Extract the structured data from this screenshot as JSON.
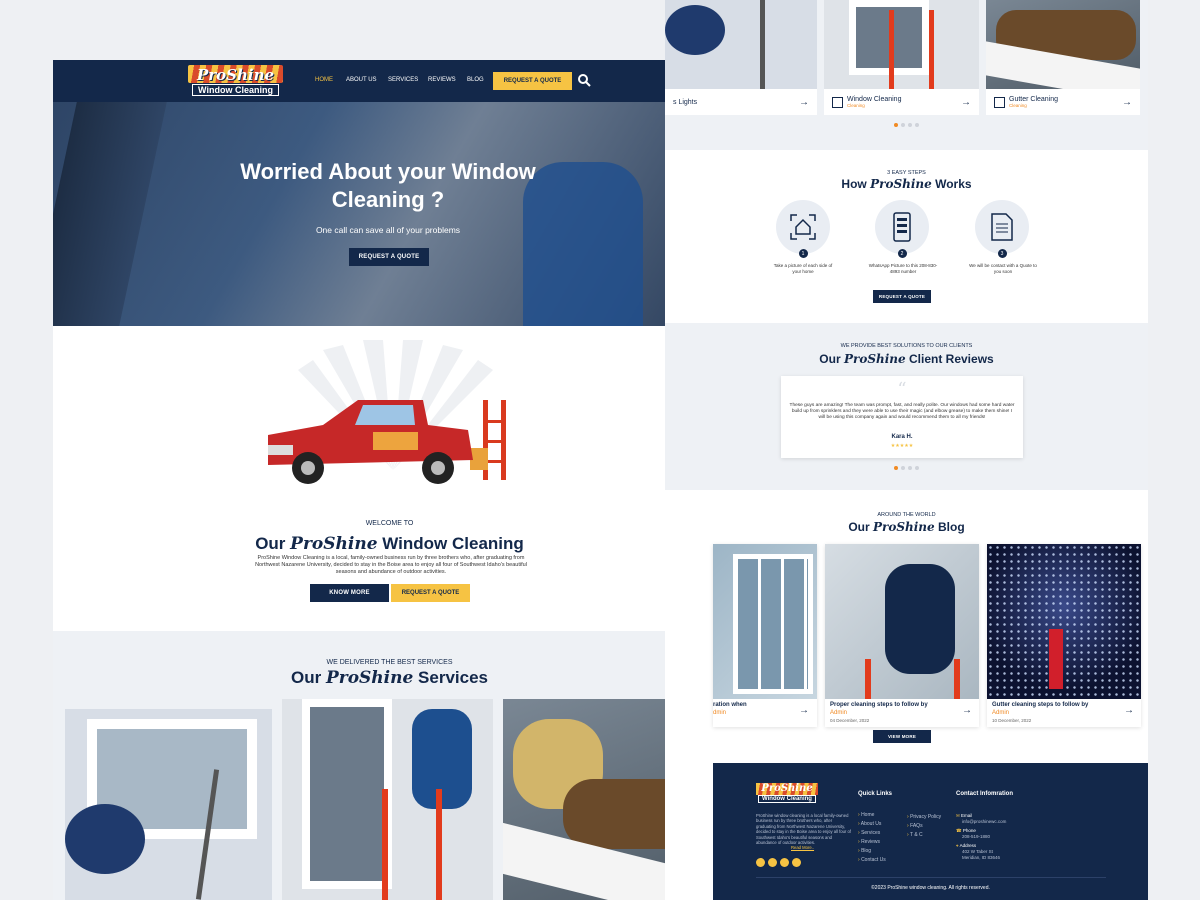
{
  "nav": {
    "logo_top": "ProShine",
    "logo_bottom": "Window Cleaning",
    "items": [
      "HOME",
      "ABOUT US",
      "SERVICES",
      "REVIEWS",
      "BLOG"
    ],
    "cta": "REQUEST A QUOTE"
  },
  "hero": {
    "title": "Worried About your Window Cleaning ?",
    "subtitle": "One call can save all of your problems",
    "cta": "REQUEST A QUOTE"
  },
  "welcome": {
    "eyebrow": "WELCOME TO",
    "title_pre": "Our",
    "title_brand": "ProShine",
    "title_post": "Window Cleaning",
    "body": "ProShine Window Cleaning is a local, family-owned business run by three brothers who, after graduating from Northwest Nazarene University, decided to stay in the Boise area to enjoy all four of Southwest Idaho's beautiful seasons and abundance of outdoor activities.",
    "btn_more": "KNOW MORE",
    "btn_quote": "REQUEST A QUOTE"
  },
  "services": {
    "eyebrow": "WE DELIVERED THE BEST SERVICES",
    "title_pre": "Our",
    "title_brand": "ProShine",
    "title_post": "Services",
    "cards": [
      {
        "title": "s Lights",
        "sub": ""
      },
      {
        "title": "Window Cleaning",
        "sub": "Cleaning"
      },
      {
        "title": "Gutter Cleaning",
        "sub": "Cleaning"
      }
    ]
  },
  "how": {
    "eyebrow": "3 EASY STEPS",
    "title_pre": "How",
    "title_brand": "ProShine",
    "title_post": "Works",
    "steps": [
      {
        "num": "1",
        "text": "Take a picture of each side of your home"
      },
      {
        "num": "2",
        "text": "WhatsApp Picture to this 208-830-4893 number"
      },
      {
        "num": "3",
        "text": "We will be contact with a Quote to you soon"
      }
    ],
    "cta": "REQUEST A QUOTE"
  },
  "reviews": {
    "eyebrow": "WE PROVIDE BEST SOLUTIONS TO OUR CLIENTS",
    "title_pre": "Our",
    "title_brand": "ProShine",
    "title_post": "Client Reviews",
    "quote": "These guys are amazing! The team was prompt, fast, and really polite. Our windows had some hard water build up from sprinklers and they were able to use their magic (and elbow grease) to make them shine! I will be using this company again and would recommend them to all my friends!",
    "author": "Kara H.",
    "stars": "★★★★★"
  },
  "blog": {
    "eyebrow": "AROUND THE WORLD",
    "title_pre": "Our",
    "title_brand": "ProShine",
    "title_post": "Blog",
    "posts": [
      {
        "title": "ration when",
        "author": "dmin",
        "date": ""
      },
      {
        "title": "Proper cleaning steps to follow by",
        "author": "Admin",
        "date": "04 December, 2022"
      },
      {
        "title": "Gutter cleaning steps to follow by",
        "author": "Admin",
        "date": "10 December, 2022"
      }
    ],
    "cta": "VIEW MORE"
  },
  "footer": {
    "about": "ProShine window cleaning is a local family-owned business run by three brothers who, after graduating from Northwest Nazarene University, decided to stay in the Boise area to enjoy all four of Southwest Idaho's beautiful seasons and abundance of outdoor activities.",
    "read_more": "Read More..",
    "quick_title": "Quick Links",
    "links_a": [
      "Home",
      "About Us",
      "Services",
      "Reviews",
      "Blog",
      "Contact Us"
    ],
    "links_b": [
      "Privacy Policy",
      "FAQs",
      "T & C"
    ],
    "contact_title": "Contact Infomration",
    "email_label": "Email",
    "email": "info@proshinewc.com",
    "phone_label": "Phone",
    "phone": "208-519-1880",
    "address_label": "Address",
    "address": "402 W Taber St Meridian, ID 83646",
    "copyright": "©2023 ProShine window cleaning. All rights reserved."
  },
  "colors": {
    "navy": "#13284a",
    "yellow": "#f6c343",
    "orange": "#f08a24",
    "red": "#c62828"
  }
}
